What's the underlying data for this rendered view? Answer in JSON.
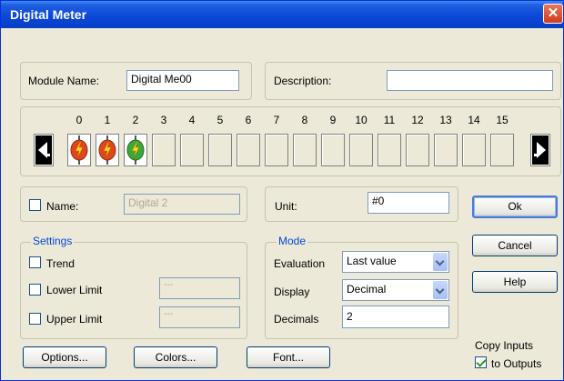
{
  "window": {
    "title": "Digital Meter",
    "close_glyph": "✕"
  },
  "module": {
    "name_label": "Module Name:",
    "name_value": "Digital Me00",
    "description_label": "Description:",
    "description_value": ""
  },
  "channels": {
    "numbers": [
      "0",
      "1",
      "2",
      "3",
      "4",
      "5",
      "6",
      "7",
      "8",
      "9",
      "10",
      "11",
      "12",
      "13",
      "14",
      "15"
    ],
    "active": [
      {
        "index": 0,
        "color": "#d98b1d",
        "state": "red"
      },
      {
        "index": 1,
        "color": "#d98b1d",
        "state": "red"
      },
      {
        "index": 2,
        "color": "#2f9d2f",
        "state": "green"
      }
    ]
  },
  "channel_settings": {
    "name_label": "Name:",
    "name_value": "Digital 2",
    "unit_label": "Unit:",
    "unit_value": "#0"
  },
  "settings": {
    "title": "Settings",
    "trend": "Trend",
    "lower_limit": "Lower Limit",
    "upper_limit": "Upper Limit",
    "lower_value": "---",
    "upper_value": "---"
  },
  "mode": {
    "title": "Mode",
    "evaluation_label": "Evaluation",
    "evaluation_value": "Last value",
    "display_label": "Display",
    "display_value": "Decimal",
    "decimals_label": "Decimals",
    "decimals_value": "2"
  },
  "buttons": {
    "ok": "Ok",
    "cancel": "Cancel",
    "help": "Help",
    "options": "Options...",
    "colors": "Colors...",
    "font": "Font..."
  },
  "copy": {
    "line1": "Copy Inputs",
    "line2": "to Outputs",
    "checked": true
  }
}
